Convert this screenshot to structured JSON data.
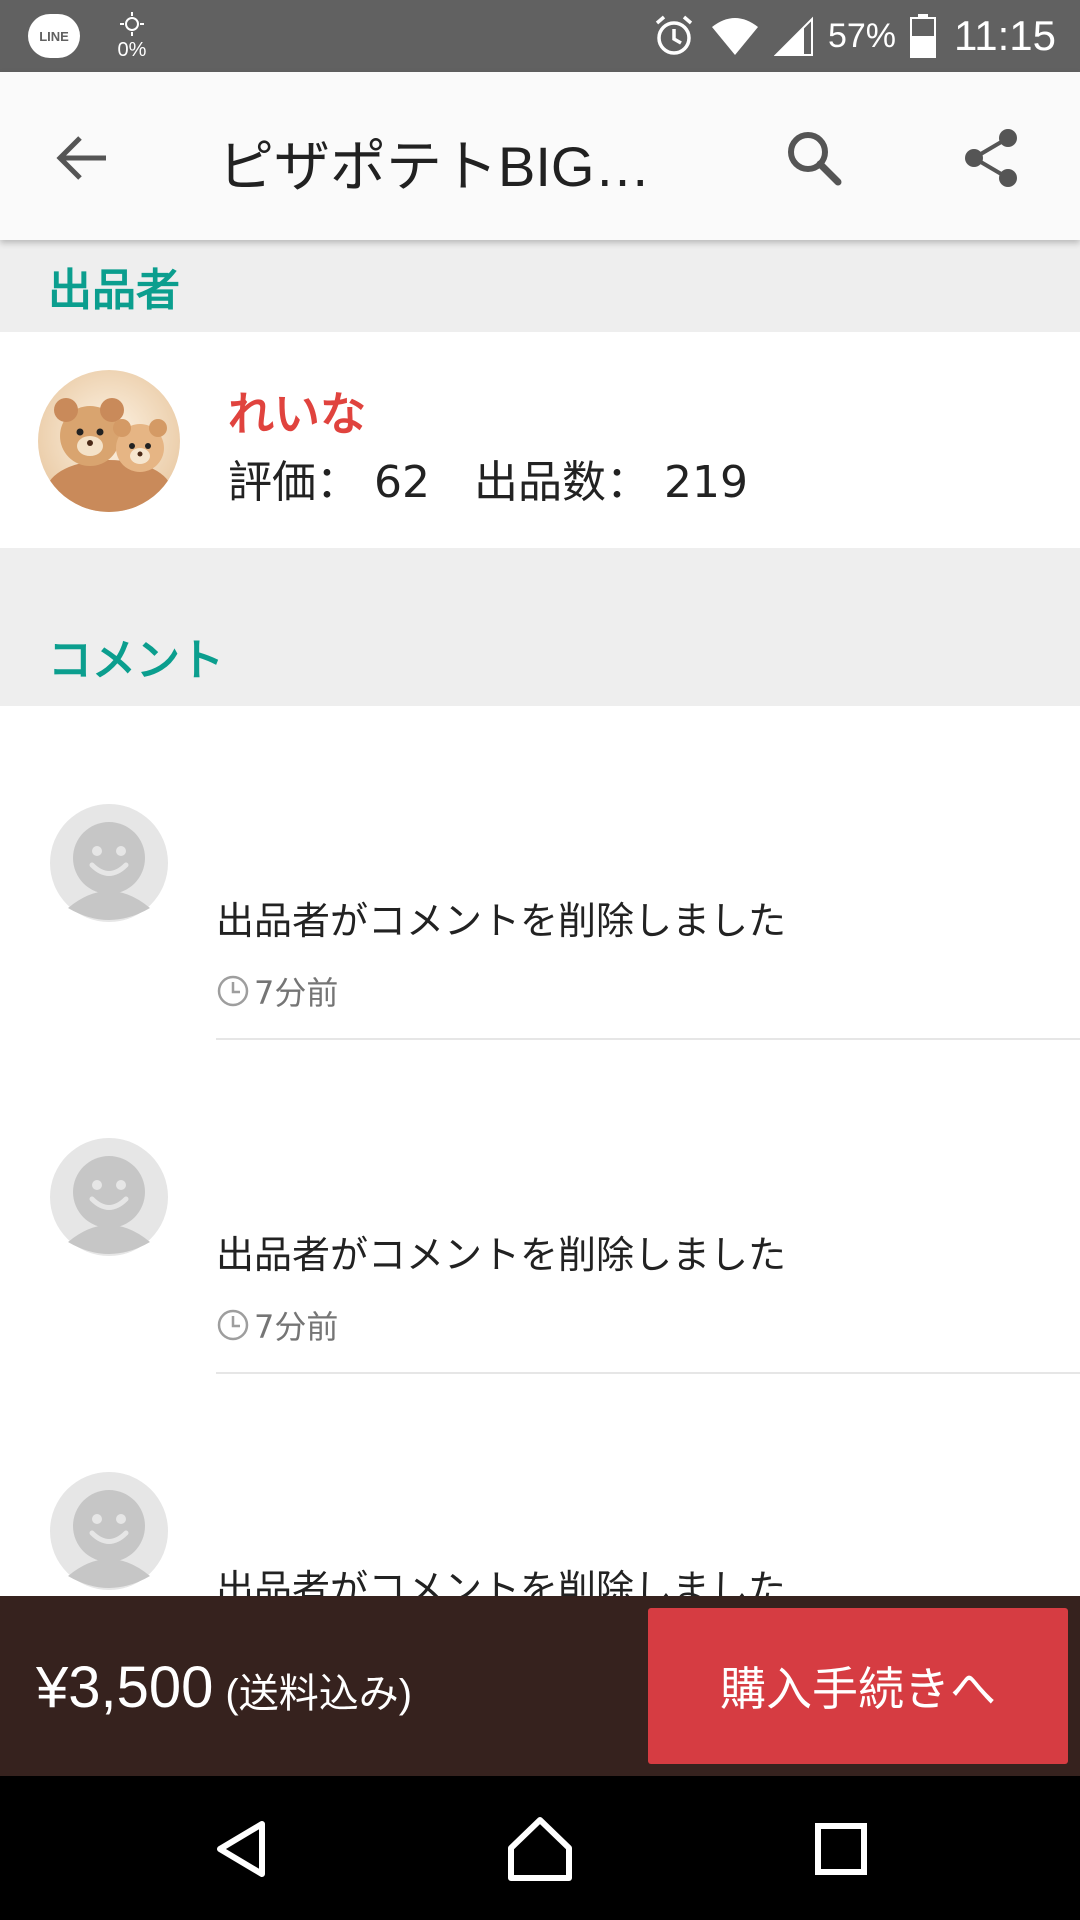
{
  "status_bar": {
    "line_label": "LINE",
    "brightness_value": "0%",
    "battery_percent": "57%",
    "time": "11:15"
  },
  "app_bar": {
    "title": "ピザポテトBIG…",
    "icons": [
      "back-arrow-icon",
      "search-icon",
      "share-icon"
    ]
  },
  "seller_section": {
    "header": "出品者",
    "name": "れいな",
    "stats": "評価： 62　出品数： 219"
  },
  "comments_section": {
    "header": "コメント",
    "items": [
      {
        "text": "出品者がコメントを削除しました",
        "time": "7分前"
      },
      {
        "text": "出品者がコメントを削除しました",
        "time": "7分前"
      },
      {
        "text": "出品者がコメントを削除しました",
        "time": ""
      }
    ]
  },
  "purchase_bar": {
    "price": "¥3,500",
    "price_note": "(送料込み)",
    "buy_label": "購入手続きへ"
  },
  "colors": {
    "accent_teal": "#0b9e8e",
    "seller_name_red": "#e0433e",
    "buy_button": "#d63c42",
    "bottom_bar": "#36221e",
    "status_bar": "#616161"
  },
  "nav_bar": {
    "icons": [
      "nav-back-icon",
      "nav-home-icon",
      "nav-recents-icon"
    ]
  }
}
